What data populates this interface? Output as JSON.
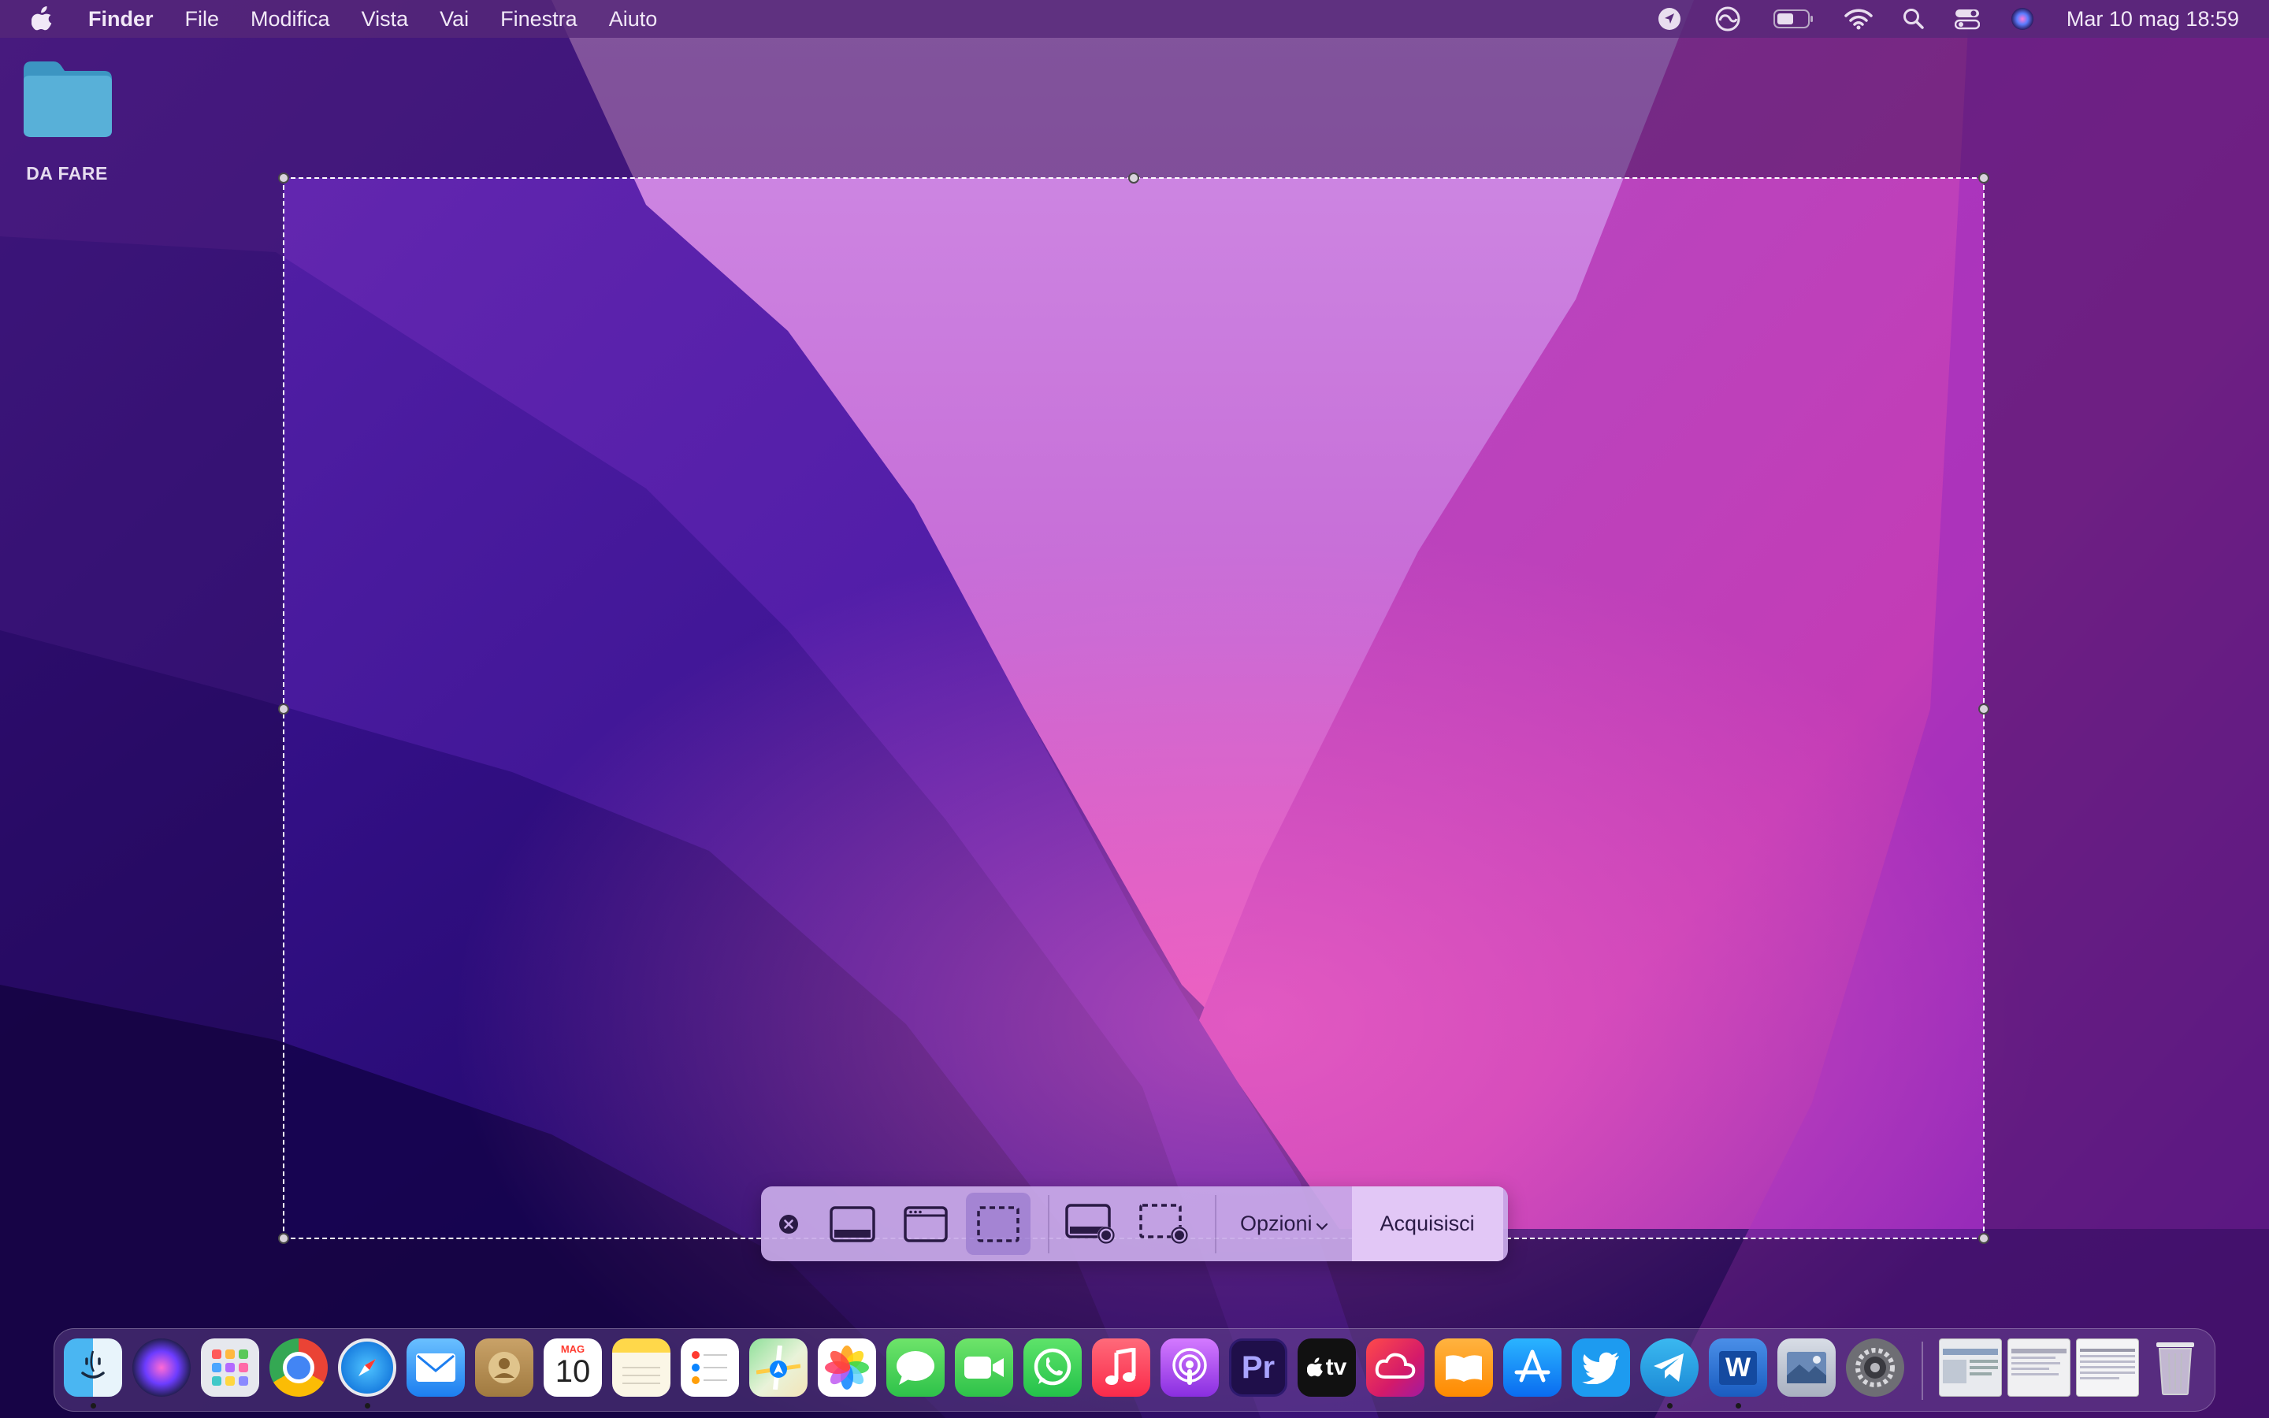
{
  "menubar": {
    "app_name": "Finder",
    "menus": [
      "File",
      "Modifica",
      "Vista",
      "Vai",
      "Finestra",
      "Aiuto"
    ],
    "clock": "Mar 10 mag  18:59",
    "status_icons": [
      "location-icon",
      "creative-cloud-icon",
      "battery-icon",
      "wifi-icon",
      "spotlight-search-icon",
      "control-center-icon",
      "siri-icon"
    ]
  },
  "desktop": {
    "folder_label": "DA FARE"
  },
  "toolbar": {
    "options_label": "Opzioni",
    "capture_label": "Acquisisci",
    "buttons": [
      "close-icon",
      "capture-entire-screen-icon",
      "capture-window-icon",
      "capture-selection-icon",
      "record-entire-screen-icon",
      "record-selection-icon"
    ]
  },
  "dock": {
    "calendar_month": "MAG",
    "calendar_day": "10",
    "premiere_label": "Pr",
    "appletv_label": "tv",
    "word_label": "W",
    "apps": [
      "Finder",
      "Siri",
      "Launchpad",
      "Chrome",
      "Safari",
      "Mail",
      "Contatti",
      "Calendario",
      "Note",
      "Promemoria",
      "Mappe",
      "Foto",
      "Messaggi",
      "FaceTime",
      "WhatsApp",
      "Musica",
      "Podcast",
      "Premiere Pro",
      "Apple TV",
      "Creative Cloud",
      "Libri",
      "App Store",
      "Twitter",
      "Telegram",
      "Word",
      "Anteprima",
      "Preferenze di Sistema"
    ]
  },
  "colors": {
    "accent": "#c8aae8",
    "menubar": "#562878",
    "wallpaper_pink": "#d94fc4",
    "wallpaper_violet": "#4a16a8"
  }
}
